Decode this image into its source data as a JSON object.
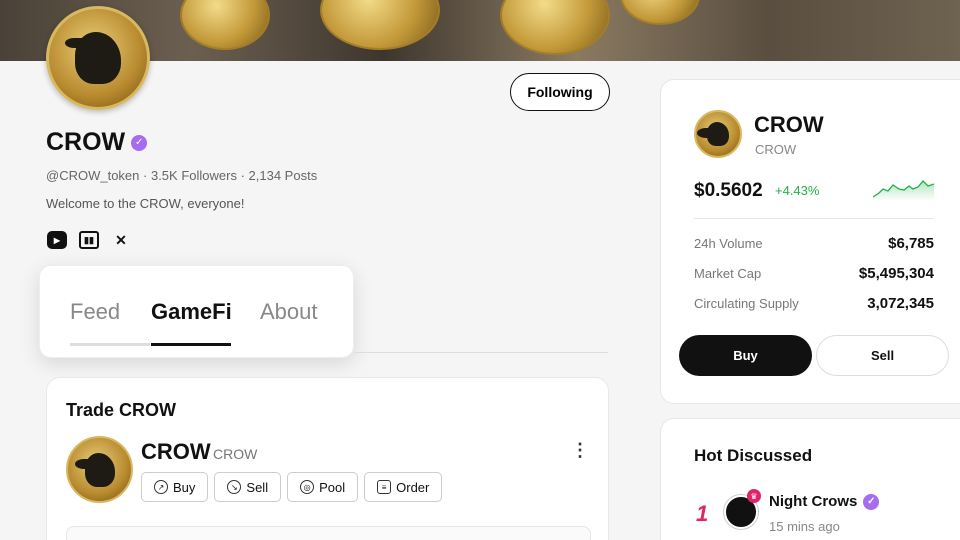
{
  "profile": {
    "name": "CROW",
    "handle": "@CROW_token",
    "followers": "3.5K Followers",
    "posts": "2,134 Posts",
    "bio": "Welcome to the CROW, everyone!",
    "follow_label": "Following"
  },
  "socials": [
    "youtube-icon",
    "twitch-icon",
    "x-icon"
  ],
  "tabs": [
    {
      "label": "Feed",
      "active": false
    },
    {
      "label": "GameFi",
      "active": true
    },
    {
      "label": "About",
      "active": false
    }
  ],
  "trade": {
    "title": "Trade CROW",
    "token_name": "CROW",
    "token_symbol": "CROW",
    "actions": [
      {
        "label": "Buy",
        "icon": "buy-icon"
      },
      {
        "label": "Sell",
        "icon": "sell-icon"
      },
      {
        "label": "Pool",
        "icon": "pool-icon"
      },
      {
        "label": "Order",
        "icon": "order-icon"
      }
    ]
  },
  "token_card": {
    "name": "CROW",
    "symbol": "CROW",
    "price": "$0.5602",
    "change": "+4.43%",
    "change_color": "#22b04b",
    "stats": [
      {
        "label": "24h Volume",
        "value": "$6,785"
      },
      {
        "label": "Market Cap",
        "value": "$5,495,304"
      },
      {
        "label": "Circulating Supply",
        "value": "3,072,345"
      }
    ],
    "buy_label": "Buy",
    "sell_label": "Sell"
  },
  "hot": {
    "title": "Hot Discussed",
    "items": [
      {
        "rank": "1",
        "name": "Night Crows",
        "time": "15 mins ago"
      }
    ]
  },
  "colors": {
    "accent": "#111111",
    "verified": "#a56cf0",
    "rank": "#e0246a"
  }
}
